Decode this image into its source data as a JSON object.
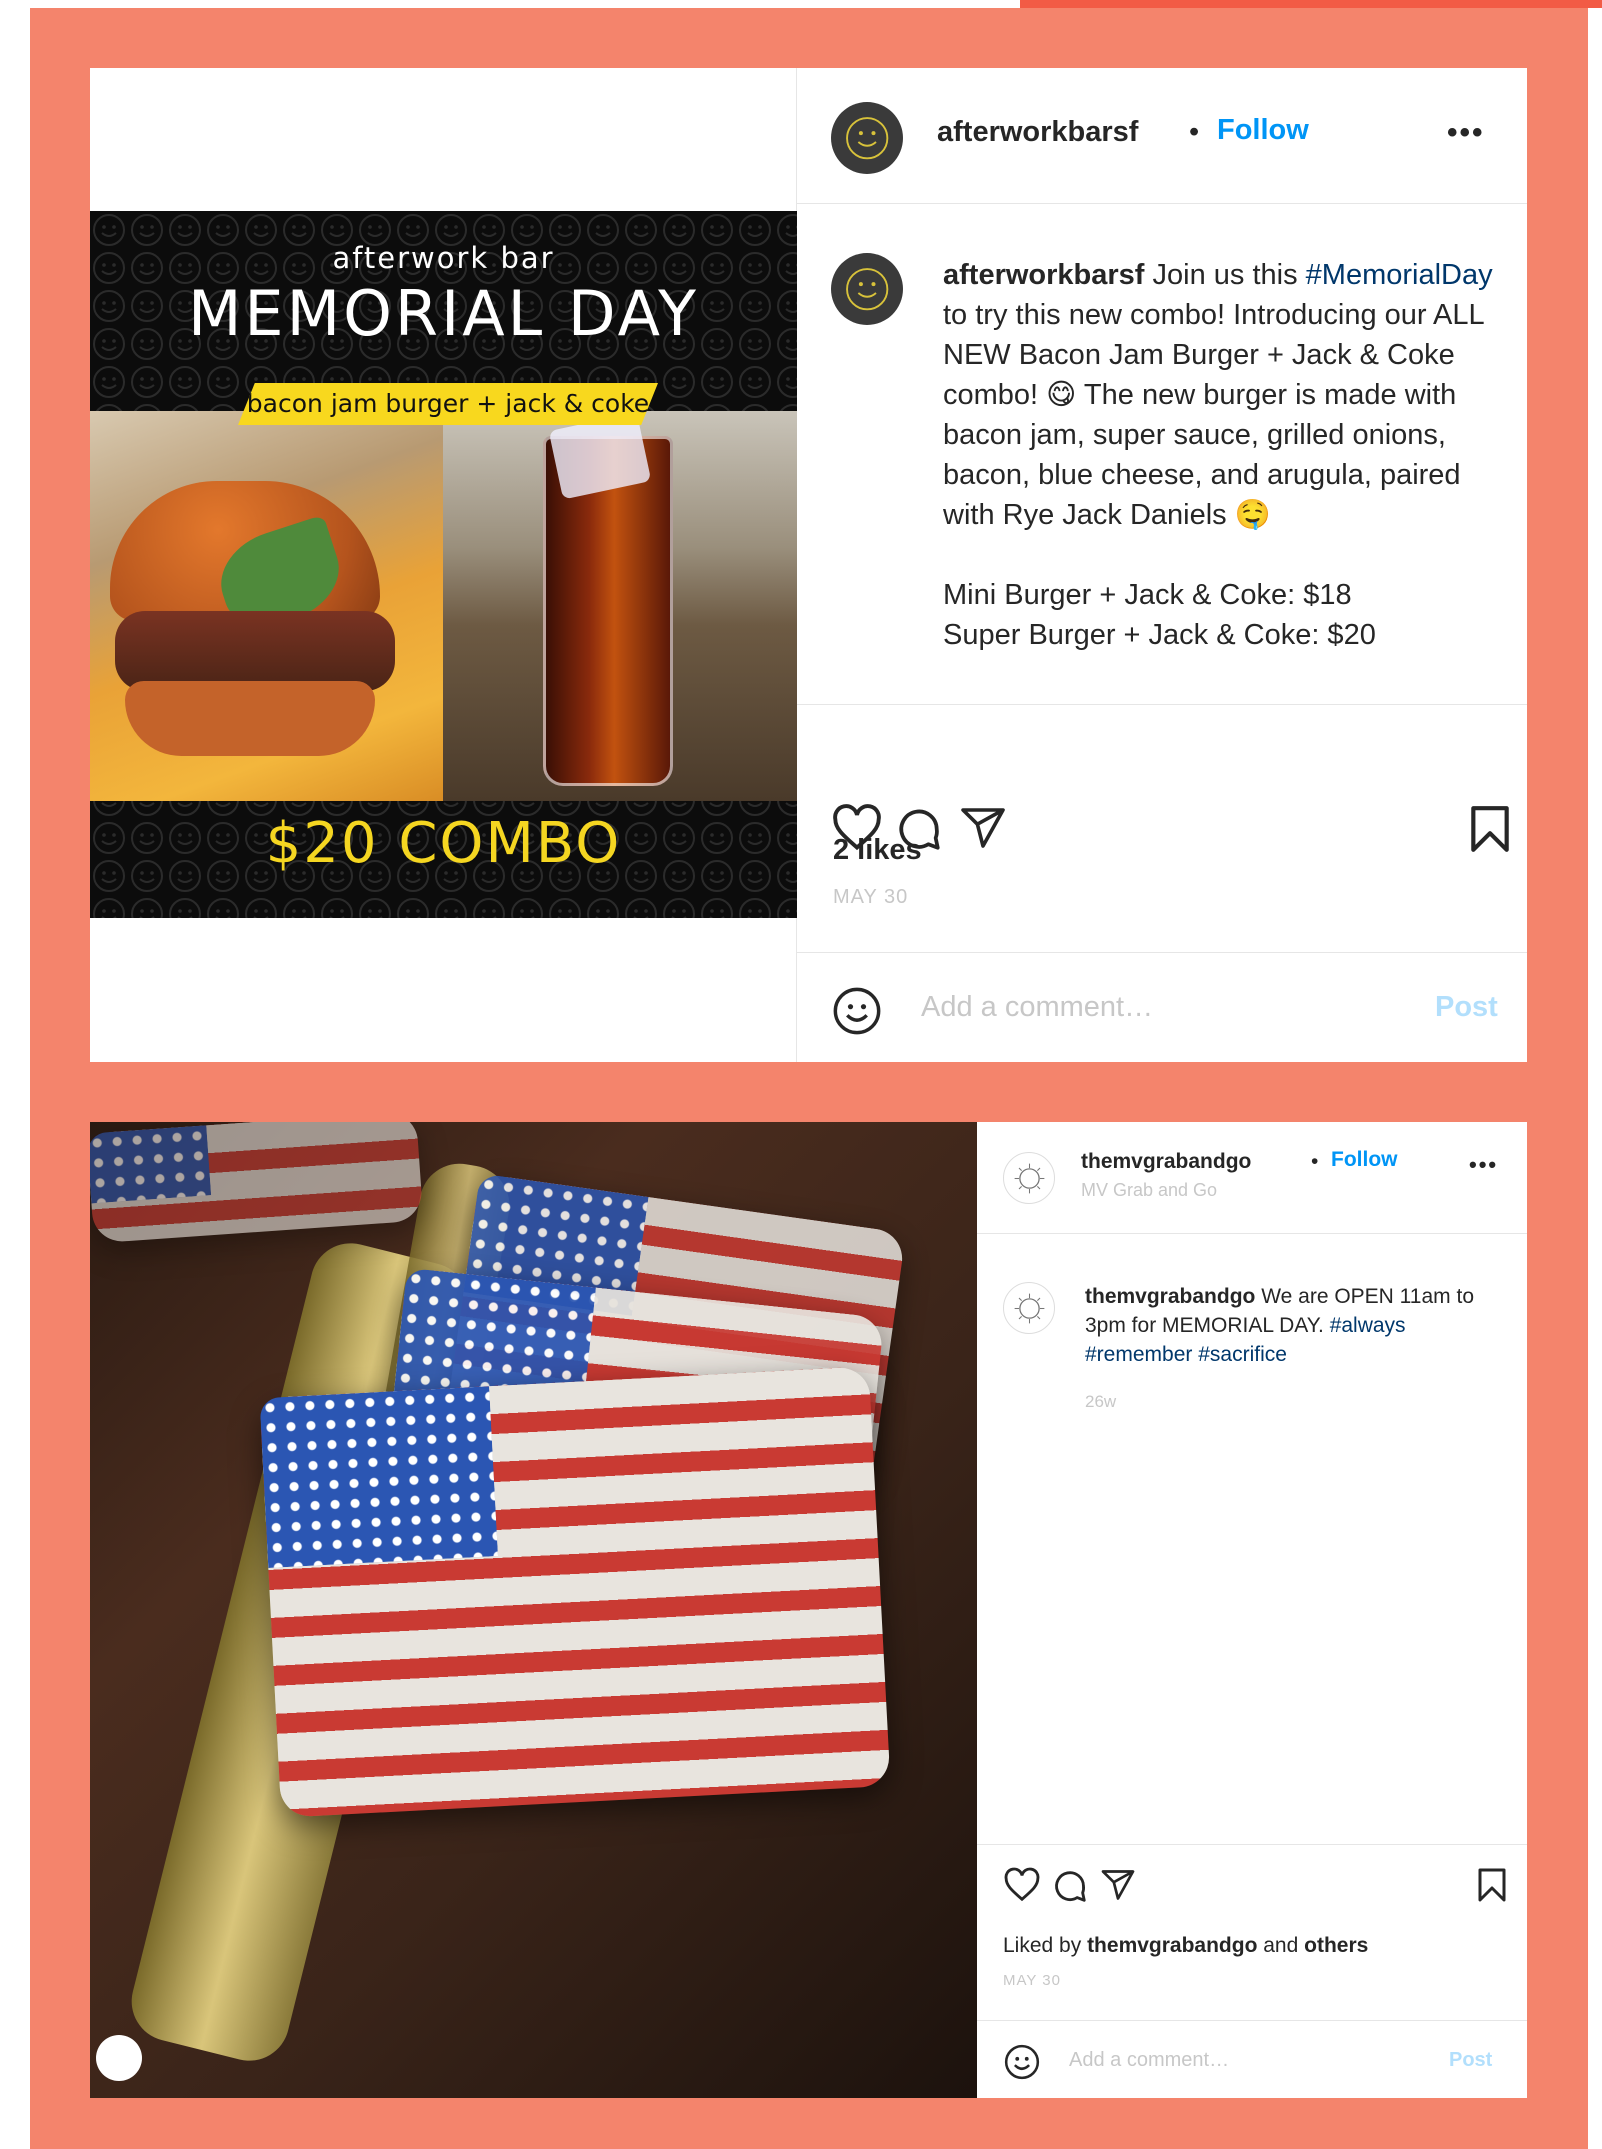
{
  "posts": [
    {
      "username": "afterworkbarsf",
      "follow_label": "Follow",
      "separator": "•",
      "more_label": "•••",
      "image": {
        "brand": "afterwork bar",
        "headline": "MEMORIAL DAY",
        "ribbon": "bacon jam burger + jack & coke",
        "combo": "$20 COMBO"
      },
      "caption": {
        "username": "afterworkbarsf",
        "text_1": " Join us this ",
        "hashtag_1": "#MemorialDay",
        "text_2": " to try this new combo! Introducing our ALL NEW Bacon Jam Burger + Jack & Coke combo! 😋 The new burger is made with bacon jam, super sauce, grilled onions, bacon, blue cheese, and arugula, paired with Rye Jack Daniels 🤤",
        "line_3": "Mini Burger + Jack & Coke: $18",
        "line_4": "Super Burger + Jack & Coke: $20"
      },
      "likes": "2 likes",
      "date": "MAY 30",
      "comment_placeholder": "Add a comment…",
      "post_label": "Post"
    },
    {
      "username": "themvgrabandgo",
      "follow_label": "Follow",
      "separator": "•",
      "subtitle": "MV Grab and Go",
      "more_label": "•••",
      "caption": {
        "username": "themvgrabandgo",
        "text_1": " We are OPEN 11am to 3pm for MEMORIAL DAY. ",
        "hashtag_1": "#always",
        "hashtag_2": "#remember",
        "hashtag_3": "#sacrifice"
      },
      "time_ago": "26w",
      "liked_by_prefix": "Liked by ",
      "liked_by_user": "themvgrabandgo",
      "liked_by_and": " and ",
      "liked_by_others": "others",
      "date": "MAY 30",
      "comment_placeholder": "Add a comment…",
      "post_label": "Post"
    }
  ],
  "colors": {
    "background": "#f4846c",
    "accent_red": "#f25b45",
    "follow_blue": "#0095f6",
    "hashtag_blue": "#00376b",
    "promo_yellow": "#f8d81e"
  }
}
